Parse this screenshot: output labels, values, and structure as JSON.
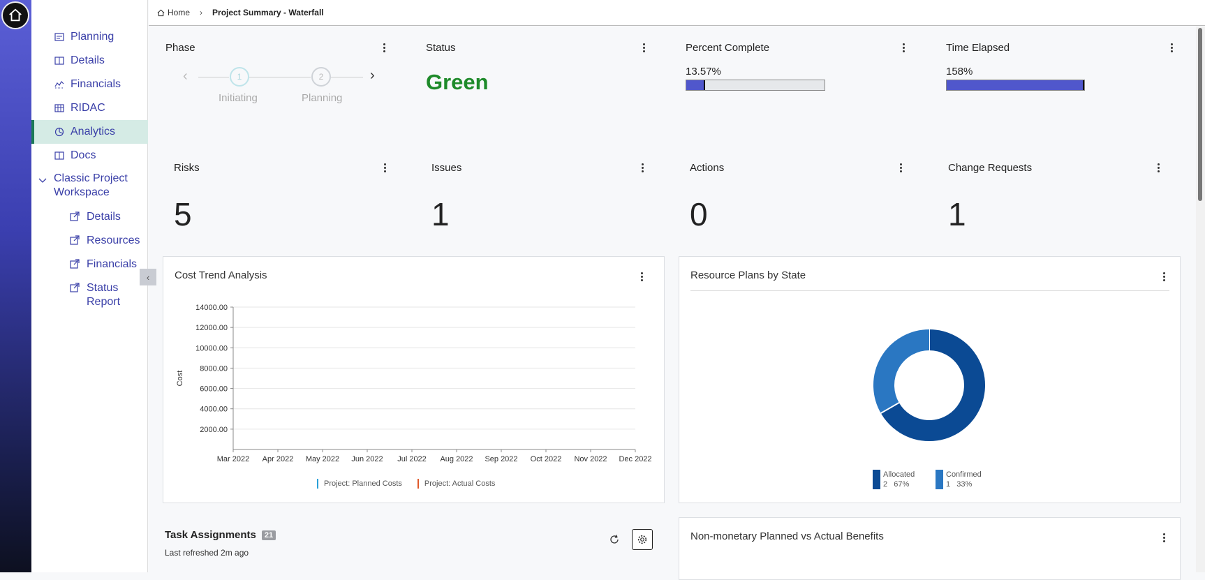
{
  "breadcrumb": {
    "home": "Home",
    "current": "Project Summary - Waterfall"
  },
  "sidebar": {
    "items": [
      {
        "label": "Planning",
        "icon": "planning-icon"
      },
      {
        "label": "Details",
        "icon": "details-icon"
      },
      {
        "label": "Financials",
        "icon": "financials-icon"
      },
      {
        "label": "RIDAC",
        "icon": "table-icon"
      },
      {
        "label": "Analytics",
        "icon": "analytics-icon",
        "active": true
      },
      {
        "label": "Docs",
        "icon": "docs-icon"
      }
    ],
    "group": {
      "label": "Classic Project Workspace",
      "items": [
        {
          "label": "Details"
        },
        {
          "label": "Resources"
        },
        {
          "label": "Financials"
        },
        {
          "label": "Status Report"
        }
      ]
    }
  },
  "tiles": {
    "phase": {
      "title": "Phase",
      "steps": [
        {
          "num": "1",
          "label": "Initiating"
        },
        {
          "num": "2",
          "label": "Planning"
        }
      ]
    },
    "status": {
      "title": "Status",
      "value": "Green",
      "color": "#1e8a2a"
    },
    "percent_complete": {
      "title": "Percent Complete",
      "value_text": "13.57%",
      "fraction": 0.1357
    },
    "time_elapsed": {
      "title": "Time Elapsed",
      "value_text": "158%",
      "fraction": 1.0
    },
    "risks": {
      "title": "Risks",
      "value": "5"
    },
    "issues": {
      "title": "Issues",
      "value": "1"
    },
    "actions": {
      "title": "Actions",
      "value": "0"
    },
    "change_requests": {
      "title": "Change Requests",
      "value": "1"
    }
  },
  "cost_trend": {
    "title": "Cost Trend Analysis",
    "legend": [
      {
        "label": "Project: Planned Costs",
        "color": "#2aa0d8"
      },
      {
        "label": "Project: Actual Costs",
        "color": "#e0592a"
      }
    ]
  },
  "resource_plans": {
    "title": "Resource Plans by State",
    "legend": [
      {
        "label": "Allocated",
        "detail": "2   67%",
        "color": "#0b4a94"
      },
      {
        "label": "Confirmed",
        "detail": "1   33%",
        "color": "#2a77c2"
      }
    ]
  },
  "task_assignments": {
    "title": "Task Assignments",
    "count": "21",
    "refreshed": "Last refreshed 2m ago"
  },
  "benefits": {
    "title": "Non-monetary Planned vs Actual Benefits"
  },
  "chart_data": [
    {
      "type": "line",
      "title": "Cost Trend Analysis",
      "xlabel": "",
      "ylabel": "Cost",
      "categories": [
        "Mar 2022",
        "Apr 2022",
        "May 2022",
        "Jun 2022",
        "Jul 2022",
        "Aug 2022",
        "Sep 2022",
        "Oct 2022",
        "Nov 2022",
        "Dec 2022"
      ],
      "yticks": [
        "2000.00",
        "4000.00",
        "6000.00",
        "8000.00",
        "10000.00",
        "12000.00",
        "14000.00"
      ],
      "ylim": [
        0,
        14000
      ],
      "series": [
        {
          "name": "Project: Planned Costs",
          "values": []
        },
        {
          "name": "Project: Actual Costs",
          "values": []
        }
      ],
      "grid": true,
      "legend": "bottom"
    },
    {
      "type": "pie",
      "title": "Resource Plans by State",
      "categories": [
        "Allocated",
        "Confirmed"
      ],
      "values": [
        2,
        1
      ],
      "colors": [
        "#0b4a94",
        "#2a77c2"
      ],
      "legend": "bottom"
    }
  ]
}
